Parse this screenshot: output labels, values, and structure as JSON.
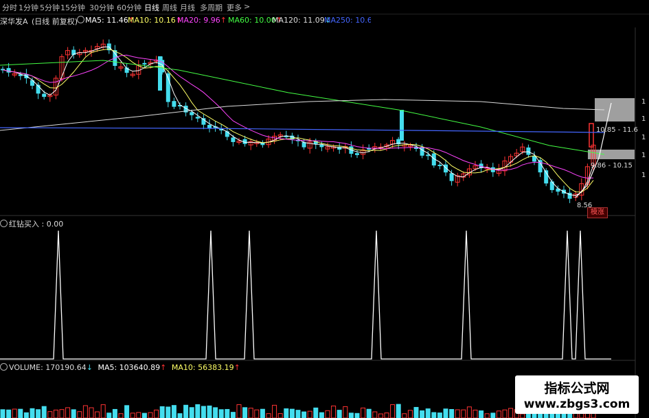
{
  "toolbar": {
    "items": [
      "分时",
      "1分钟",
      "5分钟",
      "15分钟",
      "30分钟",
      "60分钟",
      "日线",
      "周线",
      "月线",
      "多周期",
      "更多"
    ],
    "active": "日线",
    "more_chevron": ">"
  },
  "stock": {
    "name": "深华发A",
    "period": "(日线 前复权)"
  },
  "ma_legend": [
    {
      "label": "MA5: 11.46",
      "arrow": "↑",
      "color": "#ffffff"
    },
    {
      "label": "MA10: 10.16",
      "arrow": "↑",
      "color": "#ffff66"
    },
    {
      "label": "MA20: 9.96",
      "arrow": "↑",
      "color": "#ff44ff"
    },
    {
      "label": "MA60: 10.00",
      "arrow": "↑",
      "color": "#44ff44"
    },
    {
      "label": "MA120: 11.09",
      "arrow": "↓",
      "color": "#dddddd"
    },
    {
      "label": "MA250: 10.6",
      "arrow": "",
      "color": "#4466ff"
    }
  ],
  "price_labels": {
    "range_high": "10.85 - 11.6",
    "range_low": "9.86 - 10.15",
    "low_point": "8.56",
    "buy_tag": "模涨"
  },
  "right_axis_ticks": [
    "1",
    "1",
    "1",
    "1",
    "1"
  ],
  "indicator": {
    "title": "红钻买入 : 0.00"
  },
  "volume": {
    "label": "VOLUME: 170190.64",
    "arrow1": "↓",
    "ma5": "MA5: 103640.89",
    "arrow2": "↑",
    "ma10": "MA10: 56383.19",
    "arrow3": "↑"
  },
  "watermark": {
    "title": "指标公式网",
    "url": "www.zbgs3.com"
  },
  "colors": {
    "up": "#ff3333",
    "down": "#44ddee",
    "ma5": "#ffffff",
    "ma10": "#ffff66",
    "ma20": "#ff44ff",
    "ma60": "#44ff44",
    "ma120": "#dddddd",
    "ma250": "#4466ff",
    "signal": "#ffffff"
  }
}
